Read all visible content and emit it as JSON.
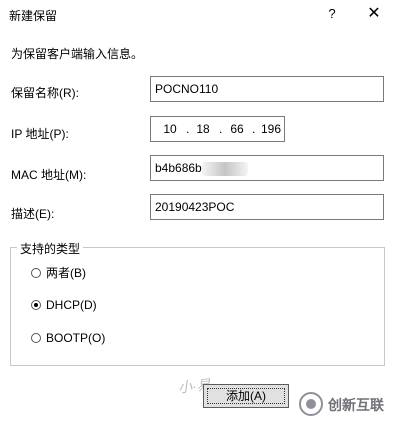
{
  "window": {
    "title": "新建保留",
    "help_glyph": "?",
    "close_glyph": "✕"
  },
  "form": {
    "intro": "为保留客户端输入信息。",
    "name_label": "保留名称(R):",
    "name_value": "POCNO110",
    "ip_label": "IP 地址(P):",
    "ip_octets": [
      "10",
      "18",
      "66",
      "196"
    ],
    "mac_label": "MAC 地址(M):",
    "mac_value": "b4b686b",
    "desc_label": "描述(E):",
    "desc_value": "20190423POC"
  },
  "support_group": {
    "title": "支持的类型",
    "options": [
      {
        "label": "两者(B)",
        "checked": false
      },
      {
        "label": "DHCP(D)",
        "checked": true
      },
      {
        "label": "BOOTP(O)",
        "checked": false
      }
    ]
  },
  "buttons": {
    "add_label": "添加(A)"
  },
  "watermark": {
    "signature": "小·易",
    "brand_text": "创新互联"
  }
}
